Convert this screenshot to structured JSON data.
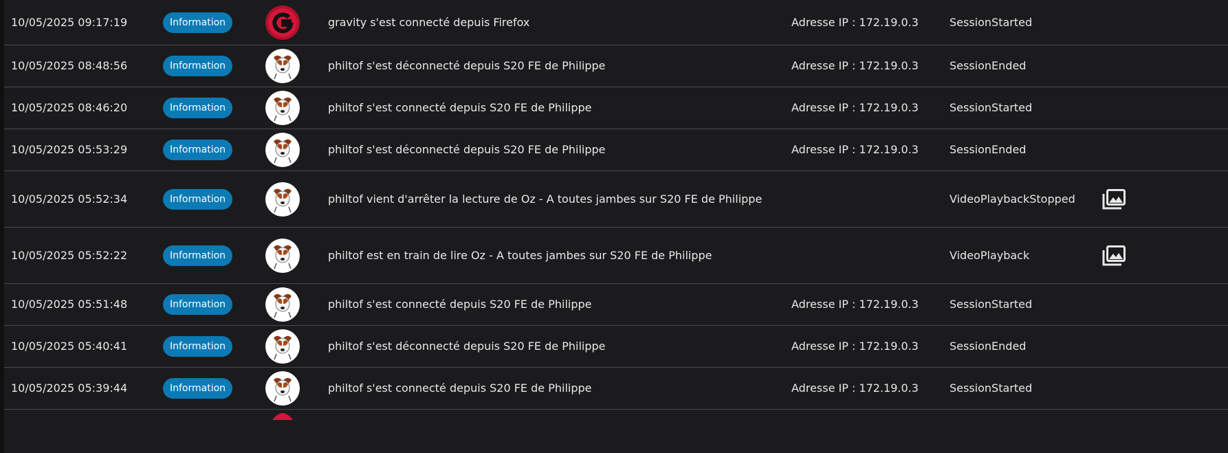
{
  "colors": {
    "background": "#1b1b1d",
    "badge": "#0b7ab5",
    "divider": "#4a4a4c",
    "text": "#e8e8e8"
  },
  "rows": [
    {
      "datetime": "10/05/2025 09:17:19",
      "severity": "Information",
      "avatar": "gravity-logo",
      "message": "gravity s'est connecté depuis Firefox",
      "ip": "Adresse IP : 172.19.0.3",
      "type": "SessionStarted",
      "media_icon": ""
    },
    {
      "datetime": "10/05/2025 08:48:56",
      "severity": "Information",
      "avatar": "dog-avatar",
      "message": "philtof s'est déconnecté depuis S20 FE de Philippe",
      "ip": "Adresse IP : 172.19.0.3",
      "type": "SessionEnded",
      "media_icon": ""
    },
    {
      "datetime": "10/05/2025 08:46:20",
      "severity": "Information",
      "avatar": "dog-avatar",
      "message": "philtof s'est connecté depuis S20 FE de Philippe",
      "ip": "Adresse IP : 172.19.0.3",
      "type": "SessionStarted",
      "media_icon": ""
    },
    {
      "datetime": "10/05/2025 05:53:29",
      "severity": "Information",
      "avatar": "dog-avatar",
      "message": "philtof s'est déconnecté depuis S20 FE de Philippe",
      "ip": "Adresse IP : 172.19.0.3",
      "type": "SessionEnded",
      "media_icon": ""
    },
    {
      "datetime": "10/05/2025 05:52:34",
      "severity": "Information",
      "avatar": "dog-avatar",
      "message": "philtof vient d'arrêter la lecture de Oz - A toutes jambes sur S20 FE de Philippe",
      "ip": "",
      "type": "VideoPlaybackStopped",
      "media_icon": "photo-library-icon"
    },
    {
      "datetime": "10/05/2025 05:52:22",
      "severity": "Information",
      "avatar": "dog-avatar",
      "message": "philtof est en train de lire Oz - A toutes jambes sur S20 FE de Philippe",
      "ip": "",
      "type": "VideoPlayback",
      "media_icon": "photo-library-icon"
    },
    {
      "datetime": "10/05/2025 05:51:48",
      "severity": "Information",
      "avatar": "dog-avatar",
      "message": "philtof s'est connecté depuis S20 FE de Philippe",
      "ip": "Adresse IP : 172.19.0.3",
      "type": "SessionStarted",
      "media_icon": ""
    },
    {
      "datetime": "10/05/2025 05:40:41",
      "severity": "Information",
      "avatar": "dog-avatar",
      "message": "philtof s'est déconnecté depuis S20 FE de Philippe",
      "ip": "Adresse IP : 172.19.0.3",
      "type": "SessionEnded",
      "media_icon": ""
    },
    {
      "datetime": "10/05/2025 05:39:44",
      "severity": "Information",
      "avatar": "dog-avatar",
      "message": "philtof s'est connecté depuis S20 FE de Philippe",
      "ip": "Adresse IP : 172.19.0.3",
      "type": "SessionStarted",
      "media_icon": ""
    }
  ]
}
